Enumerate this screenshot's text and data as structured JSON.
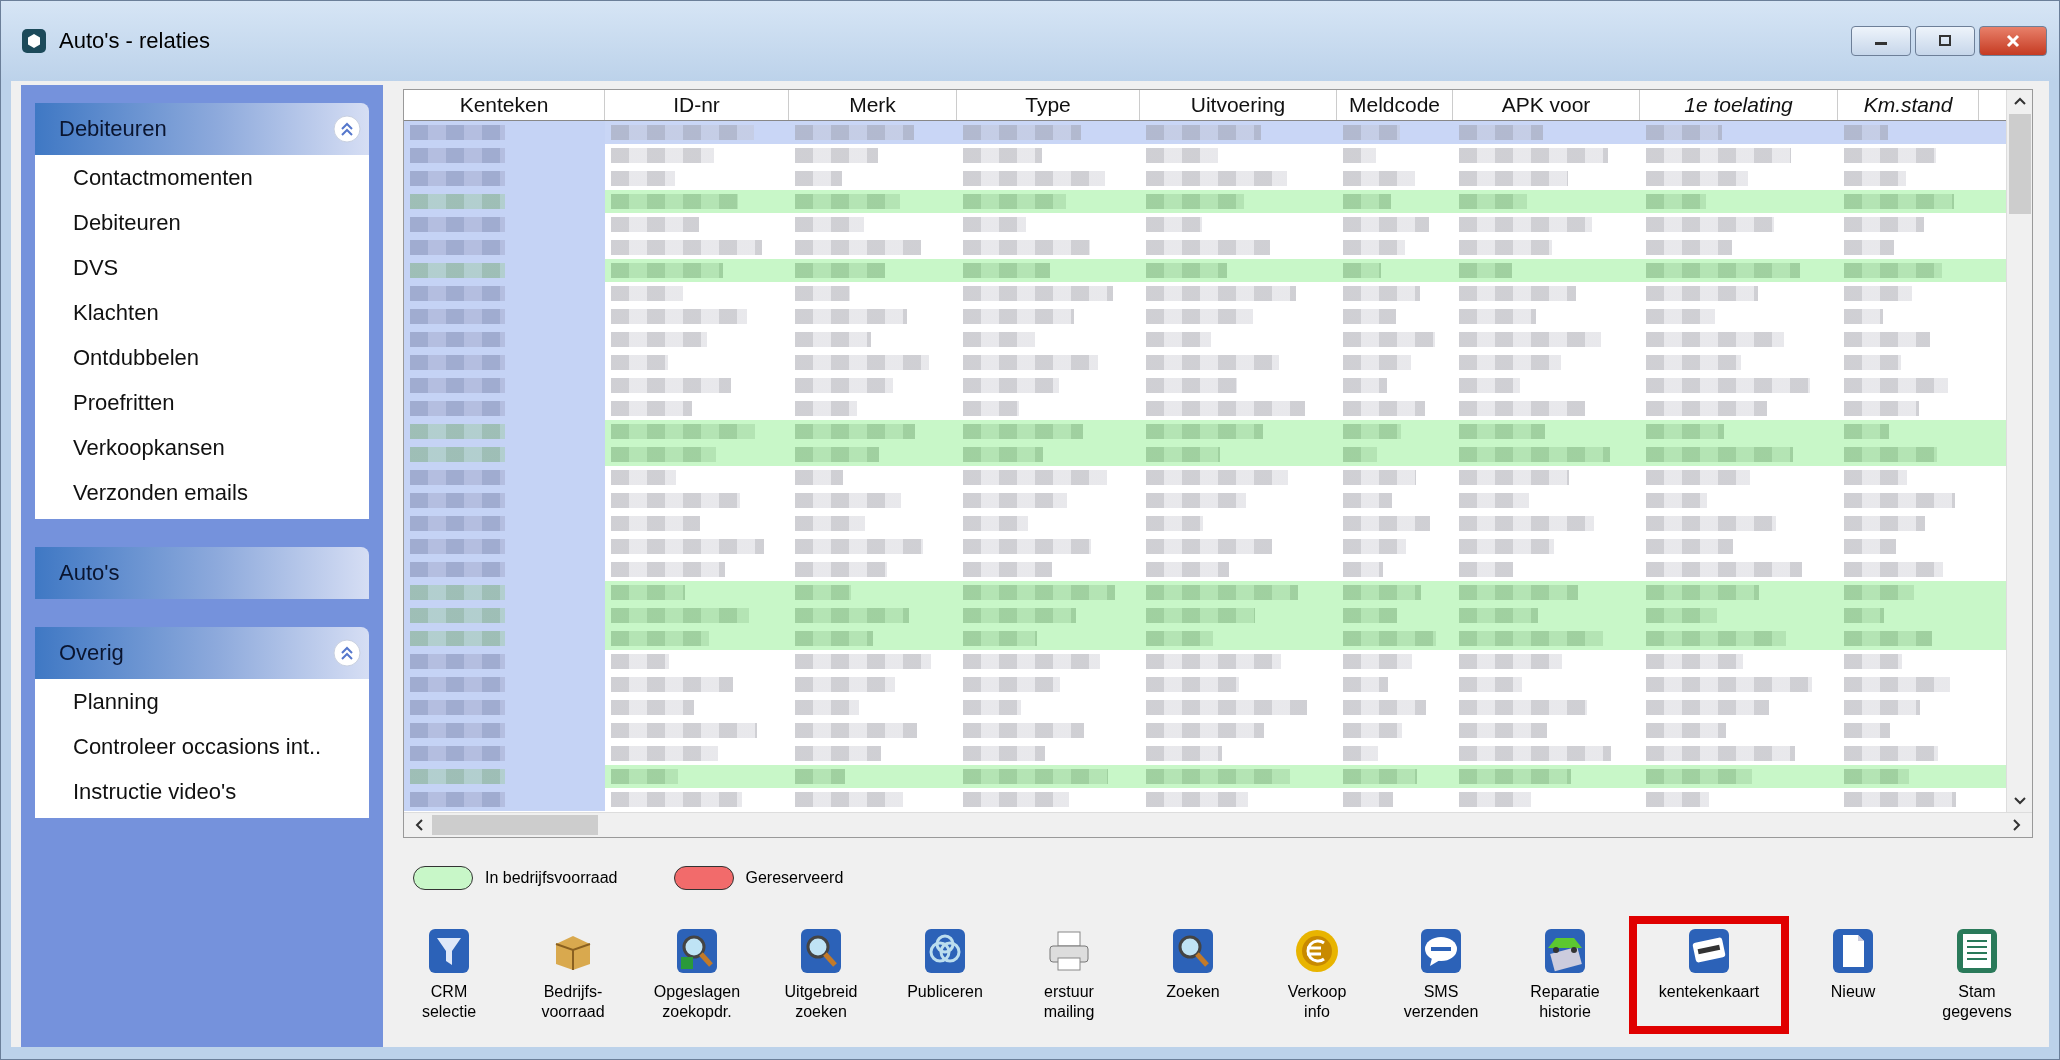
{
  "window": {
    "title": "Auto's - relaties"
  },
  "sidebar": {
    "groups": [
      {
        "title": "Debiteuren",
        "expanded": true,
        "items": [
          "Contactmomenten",
          "Debiteuren",
          "DVS",
          "Klachten",
          "Ontdubbelen",
          "Proefritten",
          "Verkoopkansen",
          "Verzonden emails"
        ]
      },
      {
        "title": "Auto's",
        "expanded": false
      },
      {
        "title": "Overig",
        "expanded": true,
        "items": [
          "Planning",
          "Controleer occasions int..",
          "Instructie video's"
        ]
      }
    ]
  },
  "table": {
    "columns": [
      {
        "label": "Kenteken",
        "italic": false
      },
      {
        "label": "ID-nr",
        "italic": false
      },
      {
        "label": "Merk",
        "italic": false
      },
      {
        "label": "Type",
        "italic": false
      },
      {
        "label": "Uitvoering",
        "italic": false
      },
      {
        "label": "Meldcode",
        "italic": false
      },
      {
        "label": "APK voor",
        "italic": false
      },
      {
        "label": "1e toelating",
        "italic": true
      },
      {
        "label": "Km.stand",
        "italic": true
      }
    ],
    "rows": [
      {
        "selected": true,
        "in_stock": false
      },
      {
        "selected": false,
        "in_stock": false
      },
      {
        "selected": false,
        "in_stock": false
      },
      {
        "selected": false,
        "in_stock": true
      },
      {
        "selected": false,
        "in_stock": false
      },
      {
        "selected": false,
        "in_stock": false
      },
      {
        "selected": false,
        "in_stock": true
      },
      {
        "selected": false,
        "in_stock": false
      },
      {
        "selected": false,
        "in_stock": false
      },
      {
        "selected": false,
        "in_stock": false
      },
      {
        "selected": false,
        "in_stock": false
      },
      {
        "selected": false,
        "in_stock": false
      },
      {
        "selected": false,
        "in_stock": false
      },
      {
        "selected": false,
        "in_stock": true
      },
      {
        "selected": false,
        "in_stock": true
      },
      {
        "selected": false,
        "in_stock": false
      },
      {
        "selected": false,
        "in_stock": false
      },
      {
        "selected": false,
        "in_stock": false
      },
      {
        "selected": false,
        "in_stock": false
      },
      {
        "selected": false,
        "in_stock": false
      },
      {
        "selected": false,
        "in_stock": true
      },
      {
        "selected": false,
        "in_stock": true
      },
      {
        "selected": false,
        "in_stock": true
      },
      {
        "selected": false,
        "in_stock": false
      },
      {
        "selected": false,
        "in_stock": false
      },
      {
        "selected": false,
        "in_stock": false
      },
      {
        "selected": false,
        "in_stock": false
      },
      {
        "selected": false,
        "in_stock": false
      },
      {
        "selected": false,
        "in_stock": true
      },
      {
        "selected": false,
        "in_stock": false
      }
    ]
  },
  "legend": [
    {
      "label": "In bedrijfsvoorraad",
      "color": "#c8f7c8"
    },
    {
      "label": "Gereserveerd",
      "color": "#f26b6b"
    }
  ],
  "toolbar": [
    {
      "label": "CRM\nselectie",
      "highlighted": false
    },
    {
      "label": "Bedrijfs-\nvoorraad",
      "highlighted": false
    },
    {
      "label": "Opgeslagen\nzoekopdr.",
      "highlighted": false
    },
    {
      "label": "Uitgebreid\nzoeken",
      "highlighted": false
    },
    {
      "label": "Publiceren",
      "highlighted": false
    },
    {
      "label": "erstuur\nmailing",
      "highlighted": false
    },
    {
      "label": "Zoeken",
      "highlighted": false
    },
    {
      "label": "Verkoop\ninfo",
      "highlighted": false
    },
    {
      "label": "SMS\nverzenden",
      "highlighted": false
    },
    {
      "label": "Reparatie\nhistorie",
      "highlighted": false
    },
    {
      "label": "kentekenkaart",
      "highlighted": true
    },
    {
      "label": "Nieuw",
      "highlighted": false
    },
    {
      "label": "Stam\ngegevens",
      "highlighted": false
    }
  ]
}
